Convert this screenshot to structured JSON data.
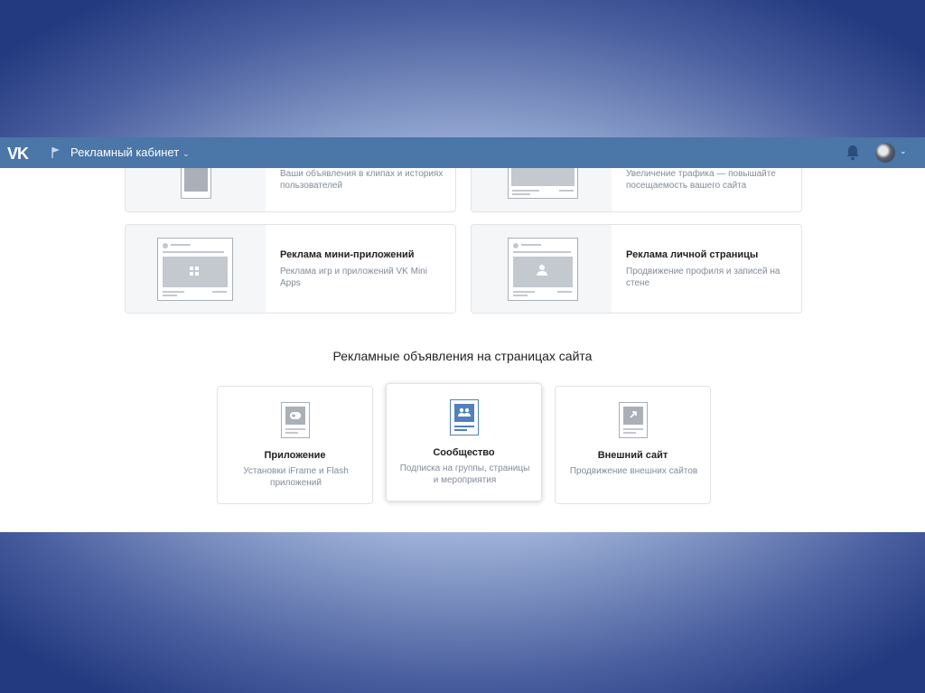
{
  "header": {
    "logo": "VK",
    "cabinet_label": "Рекламный кабинет",
    "chevron": "⌄"
  },
  "cards_top": [
    {
      "title": "",
      "desc": "Ваши объявления в клипах и историях пользователей"
    },
    {
      "title": "",
      "desc": "Увеличение трафика — повышайте посещаемость вашего сайта"
    }
  ],
  "cards_mid": [
    {
      "title": "Реклама мини-приложений",
      "desc": "Реклама игр и приложений VK Mini Apps"
    },
    {
      "title": "Реклама личной страницы",
      "desc": "Продвижение профиля и записей на стене"
    }
  ],
  "section_title": "Рекламные объявления на страницах сайта",
  "site_cards": [
    {
      "title": "Приложение",
      "desc": "Установки iFrame и Flash приложений"
    },
    {
      "title": "Сообщество",
      "desc": "Подписка на группы, страницы и мероприятия"
    },
    {
      "title": "Внешний сайт",
      "desc": "Продвижение внешних сайтов"
    }
  ],
  "colors": {
    "header": "#4a76a8",
    "accent": "#5181b8"
  }
}
